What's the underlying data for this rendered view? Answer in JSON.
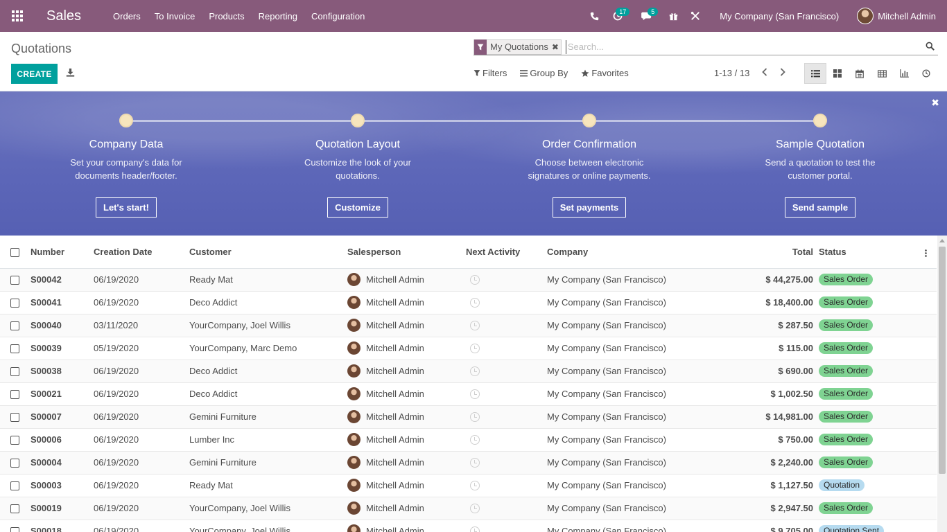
{
  "app": {
    "title": "Sales"
  },
  "menu": [
    "Orders",
    "To Invoice",
    "Products",
    "Reporting",
    "Configuration"
  ],
  "systray": {
    "activities_count": "17",
    "messages_count": "5",
    "company": "My Company (San Francisco)",
    "user": "Mitchell Admin"
  },
  "control": {
    "title": "Quotations",
    "create_label": "CREATE",
    "facet_label": "My Quotations",
    "search_placeholder": "Search...",
    "filters_label": "Filters",
    "groupby_label": "Group By",
    "favorites_label": "Favorites",
    "pager_value": "1-13 / 13"
  },
  "onboarding": {
    "steps": [
      {
        "title": "Company Data",
        "desc1": "Set your company's data for",
        "desc2": "documents header/footer.",
        "button": "Let's start!"
      },
      {
        "title": "Quotation Layout",
        "desc1": "Customize the look of your",
        "desc2": "quotations.",
        "button": "Customize"
      },
      {
        "title": "Order Confirmation",
        "desc1": "Choose between electronic",
        "desc2": "signatures or online payments.",
        "button": "Set payments"
      },
      {
        "title": "Sample Quotation",
        "desc1": "Send a quotation to test the",
        "desc2": "customer portal.",
        "button": "Send sample"
      }
    ]
  },
  "table": {
    "headers": {
      "number": "Number",
      "creation_date": "Creation Date",
      "customer": "Customer",
      "salesperson": "Salesperson",
      "next_activity": "Next Activity",
      "company": "Company",
      "total": "Total",
      "status": "Status"
    },
    "rows": [
      {
        "number": "S00042",
        "date": "06/19/2020",
        "customer": "Ready Mat",
        "salesperson": "Mitchell Admin",
        "company": "My Company (San Francisco)",
        "total": "$ 44,275.00",
        "status": "Sales Order"
      },
      {
        "number": "S00041",
        "date": "06/19/2020",
        "customer": "Deco Addict",
        "salesperson": "Mitchell Admin",
        "company": "My Company (San Francisco)",
        "total": "$ 18,400.00",
        "status": "Sales Order"
      },
      {
        "number": "S00040",
        "date": "03/11/2020",
        "customer": "YourCompany, Joel Willis",
        "salesperson": "Mitchell Admin",
        "company": "My Company (San Francisco)",
        "total": "$ 287.50",
        "status": "Sales Order"
      },
      {
        "number": "S00039",
        "date": "05/19/2020",
        "customer": "YourCompany, Marc Demo",
        "salesperson": "Mitchell Admin",
        "company": "My Company (San Francisco)",
        "total": "$ 115.00",
        "status": "Sales Order"
      },
      {
        "number": "S00038",
        "date": "06/19/2020",
        "customer": "Deco Addict",
        "salesperson": "Mitchell Admin",
        "company": "My Company (San Francisco)",
        "total": "$ 690.00",
        "status": "Sales Order"
      },
      {
        "number": "S00021",
        "date": "06/19/2020",
        "customer": "Deco Addict",
        "salesperson": "Mitchell Admin",
        "company": "My Company (San Francisco)",
        "total": "$ 1,002.50",
        "status": "Sales Order"
      },
      {
        "number": "S00007",
        "date": "06/19/2020",
        "customer": "Gemini Furniture",
        "salesperson": "Mitchell Admin",
        "company": "My Company (San Francisco)",
        "total": "$ 14,981.00",
        "status": "Sales Order"
      },
      {
        "number": "S00006",
        "date": "06/19/2020",
        "customer": "Lumber Inc",
        "salesperson": "Mitchell Admin",
        "company": "My Company (San Francisco)",
        "total": "$ 750.00",
        "status": "Sales Order"
      },
      {
        "number": "S00004",
        "date": "06/19/2020",
        "customer": "Gemini Furniture",
        "salesperson": "Mitchell Admin",
        "company": "My Company (San Francisco)",
        "total": "$ 2,240.00",
        "status": "Sales Order"
      },
      {
        "number": "S00003",
        "date": "06/19/2020",
        "customer": "Ready Mat",
        "salesperson": "Mitchell Admin",
        "company": "My Company (San Francisco)",
        "total": "$ 1,127.50",
        "status": "Quotation"
      },
      {
        "number": "S00019",
        "date": "06/19/2020",
        "customer": "YourCompany, Joel Willis",
        "salesperson": "Mitchell Admin",
        "company": "My Company (San Francisco)",
        "total": "$ 2,947.50",
        "status": "Sales Order"
      },
      {
        "number": "S00018",
        "date": "06/19/2020",
        "customer": "YourCompany, Joel Willis",
        "salesperson": "Mitchell Admin",
        "company": "My Company (San Francisco)",
        "total": "$ 9,705.00",
        "status": "Quotation Sent"
      }
    ]
  },
  "colors": {
    "brand": "#875a7b",
    "accent": "#00a09d",
    "banner": "#5c66b8",
    "status_sales_order": "#7fd392",
    "status_quotation": "#b6dbf0"
  }
}
